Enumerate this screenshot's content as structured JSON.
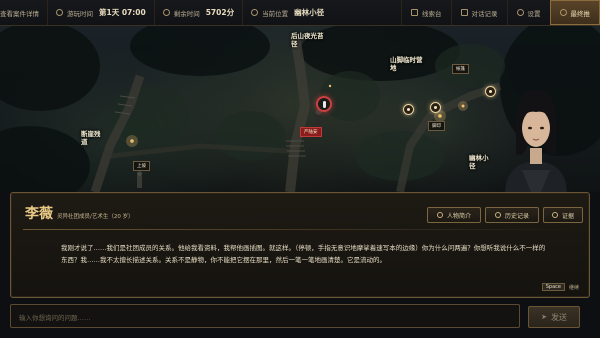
{
  "topbar": {
    "case_details": "查看案件详情",
    "game_time_label": "游玩时间",
    "game_time_value": "第1天 07:00",
    "remaining_label": "剩余时间",
    "remaining_value": "5702分",
    "location_label": "当前位置",
    "location_value": "幽林小径",
    "clues": "线索台",
    "dialogue_log": "对话记录",
    "settings": "设置",
    "final": "最终推"
  },
  "map": {
    "locations": [
      {
        "name": "后山夜光苔\n径"
      },
      {
        "name": "山脚临时营\n地"
      },
      {
        "name": "断崖残\n道"
      },
      {
        "name": "幽林小\n径"
      }
    ],
    "tags": {
      "player": "严陆安",
      "camp": "帐篷",
      "cliff": "上坡",
      "trail": "脚印"
    }
  },
  "dialog": {
    "name": "李薇",
    "role": "灵异社团成员/艺术生（20 岁）",
    "btn_profile": "人物简介",
    "btn_history": "历史记录",
    "btn_evidence": "证据",
    "text": "我刚才说了……我们是社团成员的关系。他给我看资料，我帮他画插图。就这样。（停顿，手指无意识地摩挲着速写本的边缘）你为什么问两遍？你想听我说什么不一样的东西？我……我不太擅长描述关系。关系不是静物，你不能把它摆在那里，然后一笔一笔地画清楚。它是流动的。",
    "space_key": "Space",
    "space_action": "继续"
  },
  "input": {
    "placeholder": "输入你想询问的问题……",
    "send_label": "发送"
  }
}
